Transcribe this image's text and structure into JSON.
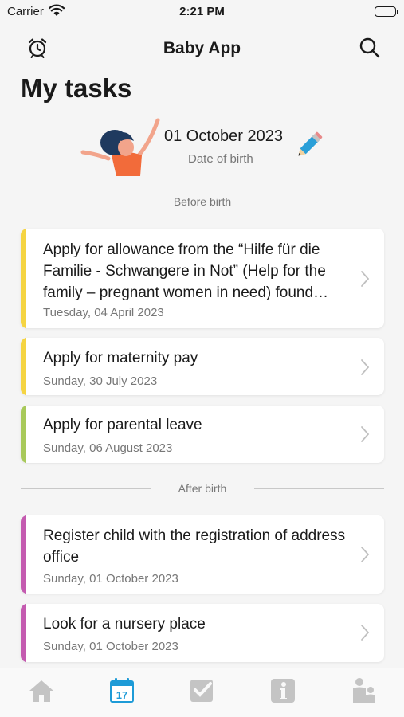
{
  "status_bar": {
    "carrier": "Carrier",
    "time": "2:21 PM"
  },
  "header": {
    "title": "Baby App",
    "left_icon": "alarm-clock-icon",
    "right_icon": "search-icon"
  },
  "page_title": "My tasks",
  "birth": {
    "date": "01 October 2023",
    "label": "Date of birth",
    "edit_icon": "pencil-icon"
  },
  "sections": [
    {
      "title": "Before birth",
      "tasks": [
        {
          "title": "Apply for allowance from the “Hilfe für die Familie - Schwangere in Not” (Help for the family – pregnant women in need) found…",
          "date": "Tuesday, 04 April 2023",
          "color": "#f5d442"
        },
        {
          "title": "Apply for maternity pay",
          "date": "Sunday, 30 July 2023",
          "color": "#f5d442"
        },
        {
          "title": "Apply for parental leave",
          "date": "Sunday, 06 August 2023",
          "color": "#a8c95a"
        }
      ]
    },
    {
      "title": "After birth",
      "tasks": [
        {
          "title": "Register child with the registration of address office",
          "date": "Sunday, 01 October 2023",
          "color": "#c45bb0"
        },
        {
          "title": "Look for a nursery place",
          "date": "Sunday, 01 October 2023",
          "color": "#c45bb0"
        }
      ]
    }
  ],
  "tab_bar": {
    "active_index": 1,
    "calendar_day": "17",
    "tabs": [
      {
        "icon": "home-icon"
      },
      {
        "icon": "calendar-icon"
      },
      {
        "icon": "checkbox-icon"
      },
      {
        "icon": "info-icon"
      },
      {
        "icon": "family-icon"
      }
    ],
    "active_color": "#1e9bd7",
    "inactive_color": "#c4c4c4"
  }
}
